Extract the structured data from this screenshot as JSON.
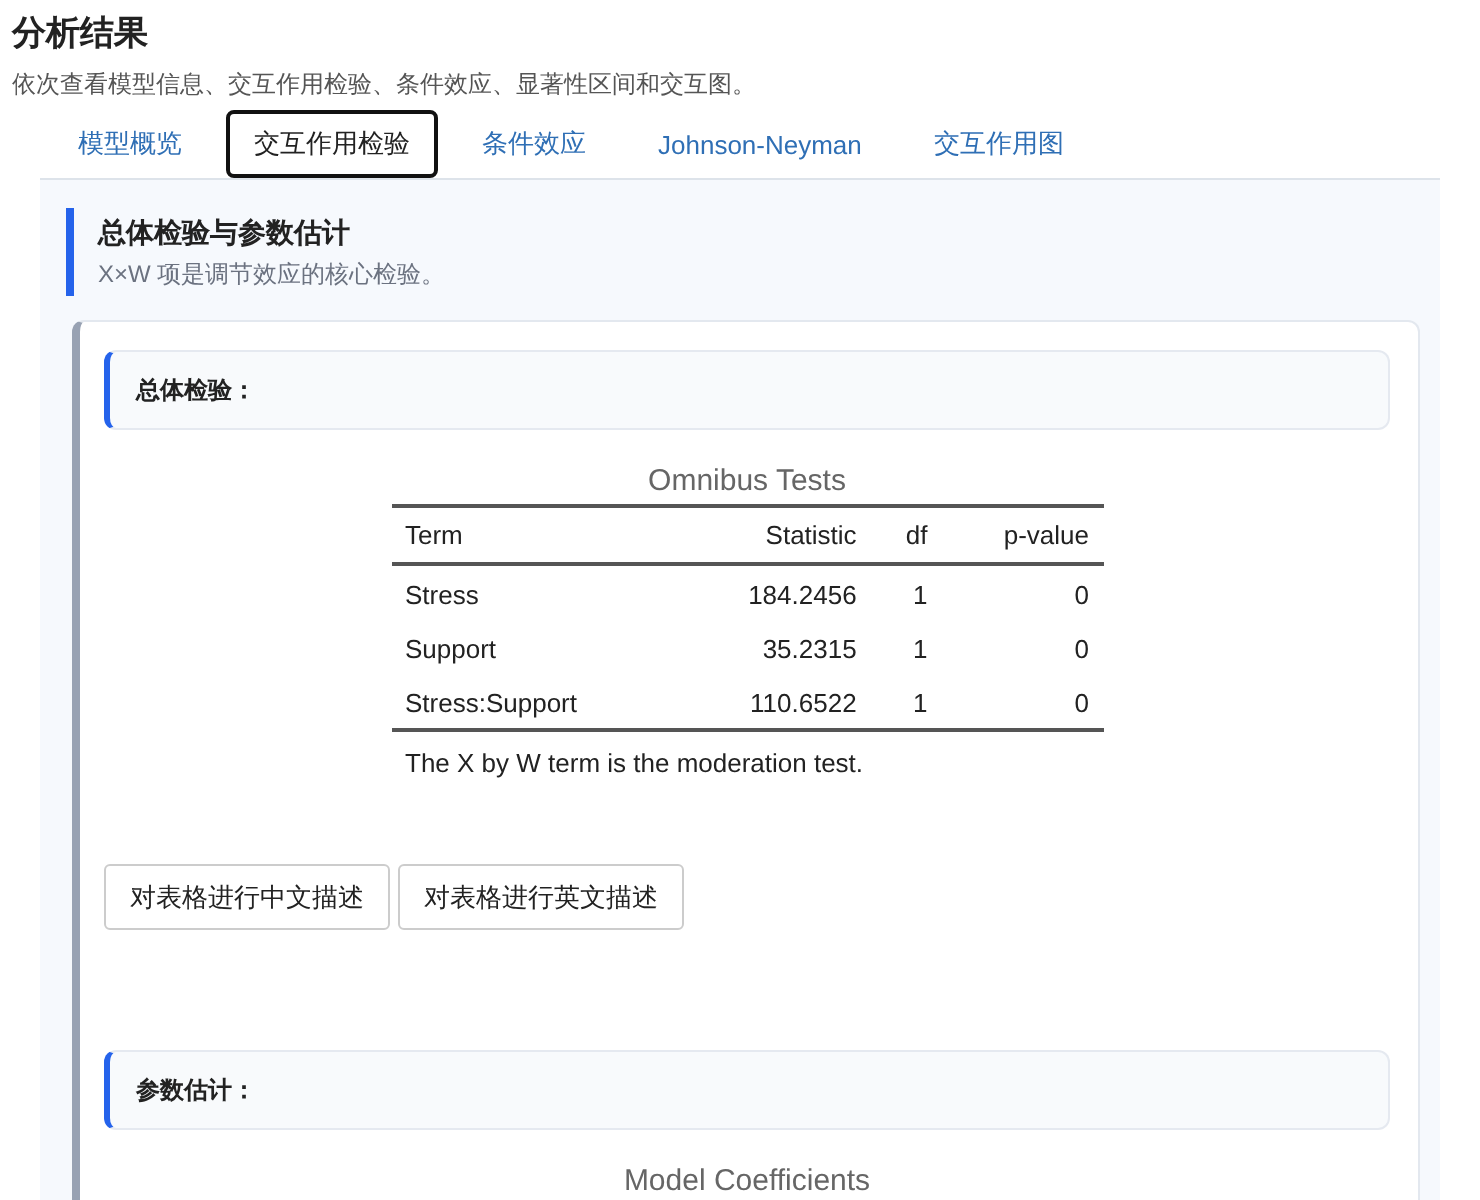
{
  "header": {
    "title": "分析结果",
    "subtitle": "依次查看模型信息、交互作用检验、条件效应、显著性区间和交互图。"
  },
  "tabs": [
    {
      "label": "模型概览",
      "selected": false
    },
    {
      "label": "交互作用检验",
      "selected": true
    },
    {
      "label": "条件效应",
      "selected": false
    },
    {
      "label": "Johnson-Neyman",
      "selected": false
    },
    {
      "label": "交互作用图",
      "selected": false
    }
  ],
  "section": {
    "title": "总体检验与参数估计",
    "subtitle": "X×W 项是调节效应的核心检验。"
  },
  "omnibus": {
    "heading": "总体检验：",
    "table": {
      "caption": "Omnibus Tests",
      "columns": [
        "Term",
        "Statistic",
        "df",
        "p-value"
      ],
      "rows": [
        [
          "Stress",
          "184.2456",
          "1",
          "0"
        ],
        [
          "Support",
          "35.2315",
          "1",
          "0"
        ],
        [
          "Stress:Support",
          "110.6522",
          "1",
          "0"
        ]
      ],
      "note": "The X by W term is the moderation test."
    },
    "buttons": [
      "对表格进行中文描述",
      "对表格进行英文描述"
    ]
  },
  "coefficients": {
    "heading": "参数估计：",
    "caption": "Model Coefficients"
  }
}
